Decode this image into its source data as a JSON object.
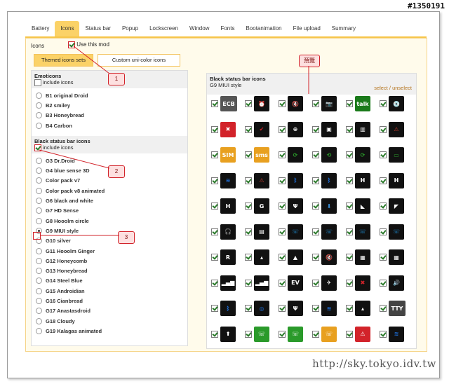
{
  "corner_id": "#1350191",
  "tabs": [
    "Battery",
    "Icons",
    "Status bar",
    "Popup",
    "Lockscreen",
    "Window",
    "Fonts",
    "Bootanimation",
    "File upload",
    "Summary"
  ],
  "active_tab": "Icons",
  "section_label": "Icons",
  "use_mod_label": "Use this mod",
  "subtabs": [
    "Themed icons sets",
    "Custom uni-color icons"
  ],
  "emoticons": {
    "title": "Emoticons",
    "include_label": "include icons",
    "options": [
      "B1 original Droid",
      "B2 smiley",
      "B3 Honeybread",
      "B4 Carbon"
    ]
  },
  "status_bar_icons": {
    "title": "Black status bar icons",
    "include_label": "include icons",
    "options": [
      "G3 Dr.Droid",
      "G4 blue sense 3D",
      "Color pack v7",
      "Color pack v8 animated",
      "G6 black and white",
      "G7 HD Sense",
      "G8 Hooolm circle",
      "G9 MIUI style",
      "G10 silver",
      "G11 Hooolm Ginger",
      "G12 Honeycomb",
      "G13 Honeybread",
      "G14 Steel Blue",
      "G15 Androidian",
      "G16 Cianbread",
      "G17 Anastasdroid",
      "G18 Cloudy",
      "G19 Kalagas animated"
    ],
    "selected": "G9 MIUI style"
  },
  "preview": {
    "title": "Black status bar icons",
    "subtitle": "G9 MIUI style",
    "select_link": "select",
    "separator": "/",
    "unselect_link": "unselect",
    "icons": [
      [
        "ECB",
        "⏰",
        "🔇",
        "📷",
        "talk",
        "💿"
      ],
      [
        "✖",
        "✔",
        "⊕",
        "▣",
        "▥",
        "⚠"
      ],
      [
        "SIM",
        "sms",
        "⟳",
        "⟲",
        "⟳",
        "▭"
      ],
      [
        "≋",
        "⚠",
        "ᛒ",
        "ᛒ",
        "H",
        "H"
      ],
      [
        "H",
        "G",
        "Ψ",
        "⬇",
        "◣",
        "◤"
      ],
      [
        "🎧",
        "▤",
        "☏",
        "☏",
        "☏",
        "☏"
      ],
      [
        "R",
        "▴",
        "▲",
        "🔇",
        "▦",
        "▦"
      ],
      [
        "▂▄▆",
        "▂▄▆",
        "EV",
        "✈",
        "✖",
        "🔊"
      ],
      [
        "ᛒ",
        "◎",
        "Ψ",
        "≋",
        "▴",
        "TTY"
      ],
      [
        "⬆",
        "☏",
        "☏",
        "☏",
        "⚠",
        "≋"
      ]
    ]
  },
  "callouts": [
    "1",
    "2",
    "3",
    "預覽"
  ],
  "watermark": "http://sky.tokyo.idv.tw"
}
